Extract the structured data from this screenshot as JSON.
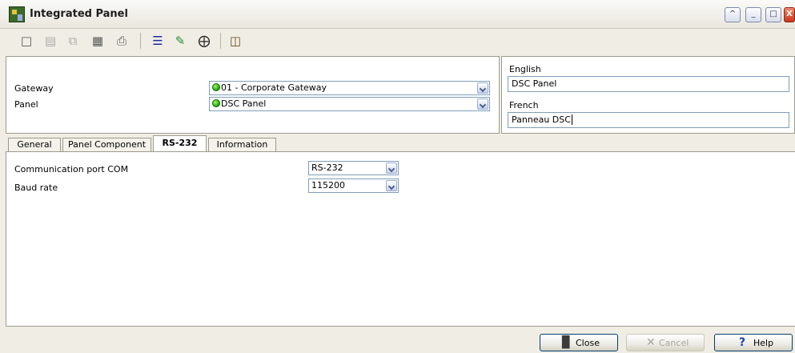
{
  "window": {
    "title": "Integrated Panel",
    "buttons": [
      "^",
      "_",
      "□",
      "X"
    ]
  },
  "toolbar": {
    "icons": [
      "new-icon",
      "save-icon",
      "copy-icon",
      "delete-icon",
      "print-icon",
      "list-icon",
      "link-icon",
      "find-icon",
      "exit-icon"
    ]
  },
  "header": {
    "gateway_label": "Gateway",
    "gateway_value": "01 - Corporate Gateway",
    "panel_label": "Panel",
    "panel_value": "DSC Panel"
  },
  "languages": {
    "english_label": "English",
    "english_value": "DSC Panel",
    "french_label": "French",
    "french_value": "Panneau DSC"
  },
  "tabs": [
    "General",
    "Panel Component",
    "RS-232",
    "Information"
  ],
  "active_tab": "RS-232",
  "rs232": {
    "port_label": "Communication port COM",
    "port_value": "RS-232",
    "baud_label": "Baud rate",
    "baud_value": "115200"
  },
  "footer": {
    "close_label": "Close",
    "cancel_label": "Cancel",
    "help_label": "Help"
  },
  "colors": {
    "status_led": "#1aa30c",
    "border": "#7f9db9"
  }
}
